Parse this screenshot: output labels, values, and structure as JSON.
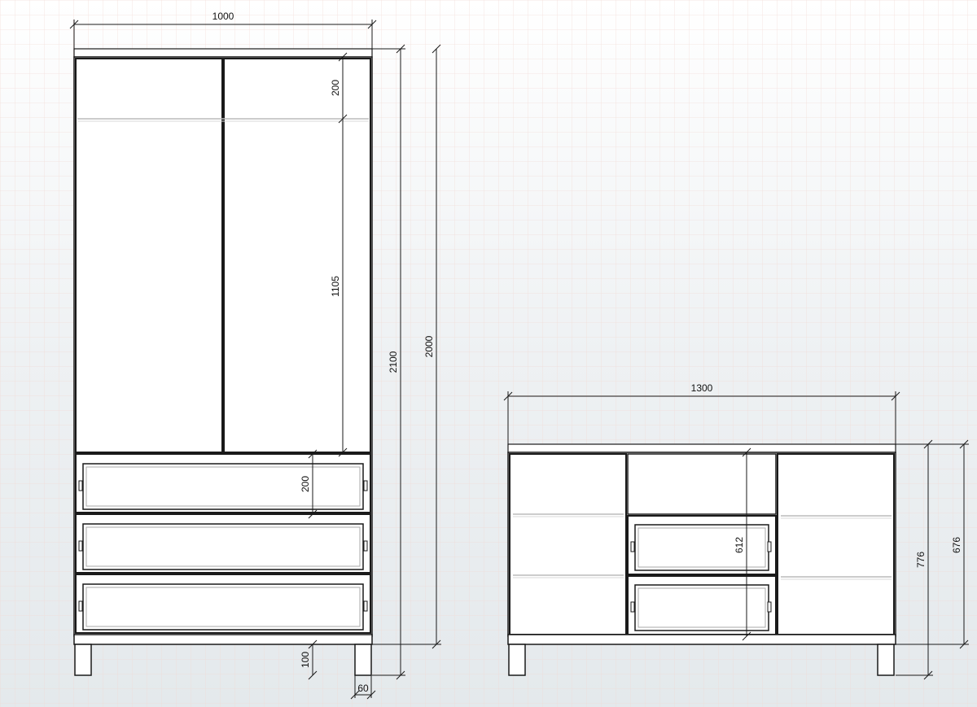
{
  "wardrobe": {
    "width_label": "1000",
    "top_section_label": "200",
    "door_height_label": "1105",
    "drawer_height_label": "200",
    "leg_height_label": "100",
    "leg_width_label": "60",
    "total_height_label": "2100",
    "body_height_label": "2000"
  },
  "dresser": {
    "width_label": "1300",
    "inner_height_label": "612",
    "total_height_label": "776",
    "body_height_label": "676"
  },
  "colors": {
    "background": "#eef1f3",
    "grid_minor": "#f3d9d3",
    "grid_major": "#e8c8c0",
    "line": "#1a1a1a",
    "panel": "#ffffff"
  }
}
